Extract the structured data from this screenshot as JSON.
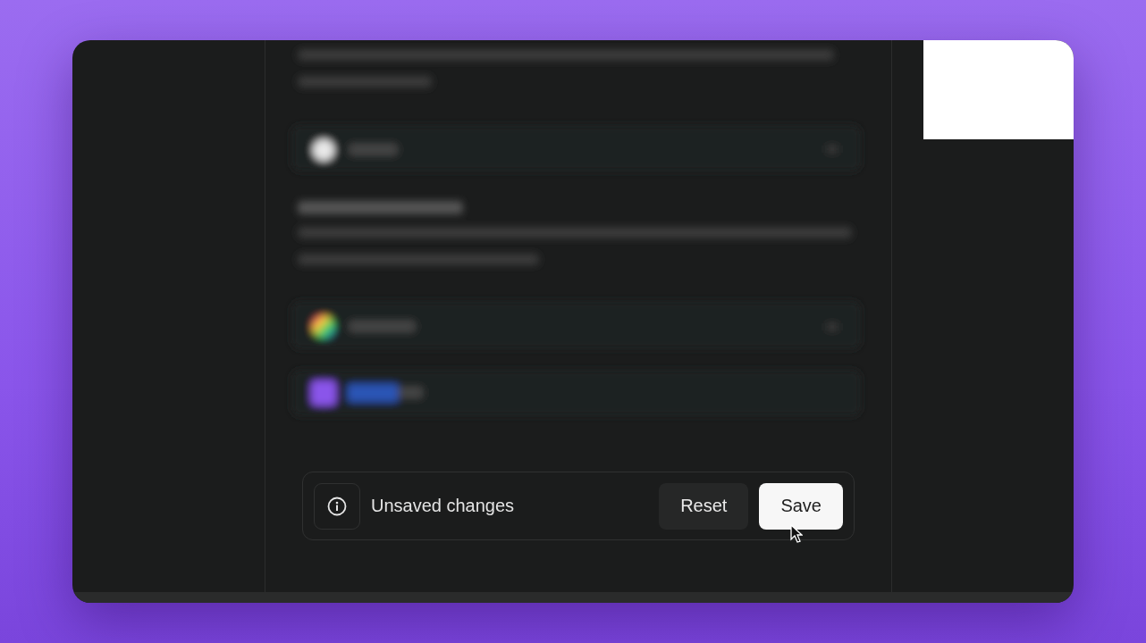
{
  "notice": {
    "message": "Unsaved changes"
  },
  "buttons": [
    {
      "label": "Reset",
      "kind": "secondary"
    },
    {
      "label": "Save",
      "kind": "primary"
    }
  ]
}
